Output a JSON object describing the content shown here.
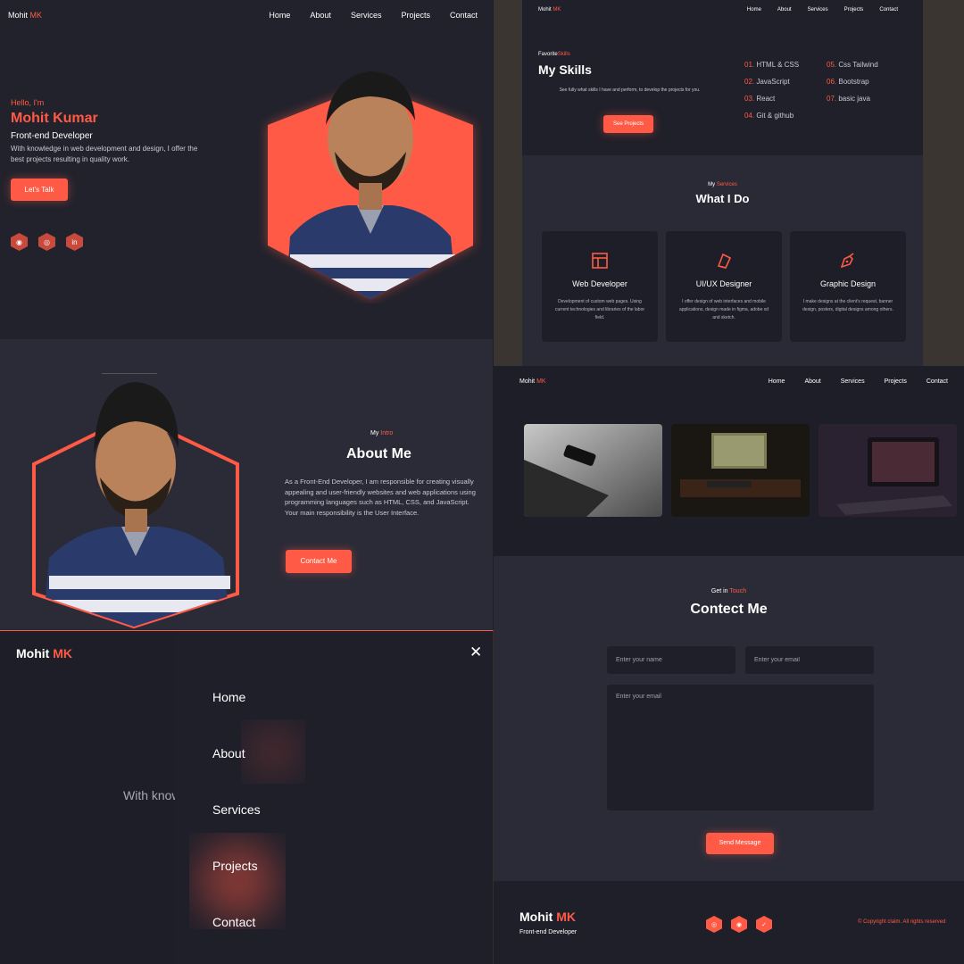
{
  "colors": {
    "accent": "#ff5a45",
    "bg_dark": "#1f1f29",
    "bg_mid": "#2b2b37"
  },
  "brand": {
    "first": "Mohit",
    "last": "MK"
  },
  "nav": [
    "Home",
    "About",
    "Services",
    "Projects",
    "Contact"
  ],
  "hero": {
    "hello": "Hello, I'm",
    "name": "Mohit Kumar",
    "role": "Front-end Developer",
    "desc": "With knowledge in web development and design, I offer the best projects resulting in quality work.",
    "cta": "Let's Talk",
    "socials": [
      "github-icon",
      "instagram-icon",
      "linkedin-icon"
    ]
  },
  "skills": {
    "eyebrow_a": "Favorite",
    "eyebrow_b": "Skills",
    "title": "My Skills",
    "desc": "See fully what skills I have and perform, to develop the projects for you.",
    "cta": "See Projects",
    "items": [
      {
        "num": "01.",
        "label": "HTML & CSS"
      },
      {
        "num": "05.",
        "label": "Css Tailwind"
      },
      {
        "num": "02.",
        "label": "JavaScript"
      },
      {
        "num": "06.",
        "label": "Bootstrap"
      },
      {
        "num": "03.",
        "label": "React"
      },
      {
        "num": "07.",
        "label": "basic java"
      },
      {
        "num": "04.",
        "label": "Git & github"
      }
    ]
  },
  "services": {
    "eyebrow_a": "My",
    "eyebrow_b": "Services",
    "title": "What I Do",
    "cards": [
      {
        "icon": "layout-icon",
        "title": "Web Developer",
        "desc": "Development of custom web pages. Using current technologies and libraries of the labor field."
      },
      {
        "icon": "ui-ux-icon",
        "title": "UI/UX Designer",
        "desc": "I offer design of web interfaces and mobile applications, design made in figma, adobe xd and sketch."
      },
      {
        "icon": "pen-tool-icon",
        "title": "Graphic Design",
        "desc": "I make designs at the client's request, banner design, posters, digital designs among others."
      }
    ]
  },
  "about": {
    "eyebrow_a": "My",
    "eyebrow_b": "Intro",
    "title": "About Me",
    "desc": "As a Front-End Developer, I am responsible for creating visually appealing and user-friendly websites and web applications using programming languages such as HTML, CSS, and JavaScript. Your main responsibility is the User Interface.",
    "cta": "Contact Me"
  },
  "mobile_menu": {
    "hidden_text": "With knowledge in web development and design, I",
    "items": [
      "Home",
      "About",
      "Services",
      "Projects",
      "Contact"
    ]
  },
  "contact": {
    "eyebrow_a": "Get in",
    "eyebrow_b": "Touch",
    "title": "Contect Me",
    "name_placeholder": "Enter your name",
    "email_placeholder": "Enter your email",
    "message_placeholder": "Enter your email",
    "cta": "Send Message"
  },
  "footer": {
    "role": "Front-end Developer",
    "copyright": "© Copyright claim. All rights reserved",
    "socials": [
      "instagram-icon",
      "instagram-icon",
      "twitter-icon"
    ]
  }
}
